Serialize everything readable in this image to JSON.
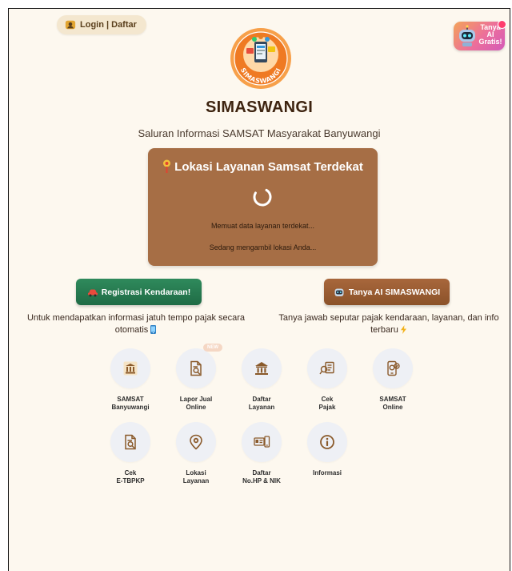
{
  "header": {
    "login_label": "Login | Daftar",
    "ai_badge_text": "Tanya AI Gratis!",
    "ai_badge_line1": "Tanya",
    "ai_badge_line2": "AI",
    "ai_badge_line3": "Gratis!"
  },
  "brand": {
    "logo_text": "SIMASWANGI",
    "title": "SIMASWANGI",
    "subtitle": "Saluran Informasi SAMSAT Masyarakat Banyuwangi"
  },
  "location_card": {
    "title": "Lokasi Layanan Samsat Terdekat",
    "loading_msg": "Memuat data layanan terdekat...",
    "locating_msg": "Sedang mengambil lokasi Anda..."
  },
  "actions": {
    "register_label": "Registrasi Kendaraan!",
    "register_desc": "Untuk mendapatkan informasi jatuh tempo pajak secara otomatis",
    "ai_label": "Tanya AI SIMASWANGI",
    "ai_desc": "Tanya jawab seputar pajak kendaraan, layanan, dan info terbaru"
  },
  "menu": {
    "new_badge": "NEW",
    "items": [
      {
        "label": "SAMSAT\nBanyuwangi",
        "icon": "samsat-logo-icon"
      },
      {
        "label": "Lapor Jual\nOnline",
        "icon": "document-search-icon"
      },
      {
        "label": "Daftar\nLayanan",
        "icon": "bank-building-icon"
      },
      {
        "label": "Cek\nPajak",
        "icon": "tax-check-icon"
      },
      {
        "label": "SAMSAT\nOnline",
        "icon": "mobile-payment-icon"
      },
      {
        "label": "Cek\nE-TBPKP",
        "icon": "document-search-icon"
      },
      {
        "label": "Lokasi\nLayanan",
        "icon": "location-pin-icon"
      },
      {
        "label": "Daftar\nNo.HP & NIK",
        "icon": "id-card-icon"
      },
      {
        "label": "Informasi",
        "icon": "info-icon"
      }
    ]
  },
  "colors": {
    "background": "#fdf8ef",
    "brown_card": "#a66e45",
    "green_button": "#2f8a5c",
    "brown_button": "#a8673c",
    "icon_circle": "#eef0f5",
    "icon_brown": "#8a5a2b"
  }
}
